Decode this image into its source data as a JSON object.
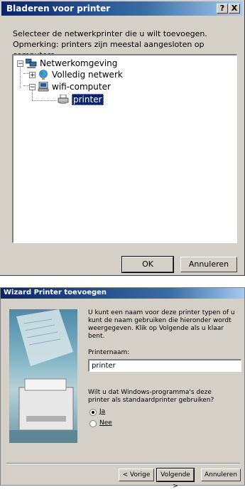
{
  "browse_dialog": {
    "title": "Bladeren voor printer",
    "help_button": "?",
    "close_button": "X",
    "instruction_line1": "Selecteer de netwerkprinter die u wilt toevoegen.",
    "instruction_line2": "Opmerking: printers zijn meestal aangesloten op computers.",
    "tree": [
      {
        "label": "Netwerkomgeving",
        "expander": "−",
        "icon": "network-neighborhood-icon"
      },
      {
        "label": "Volledig netwerk",
        "expander": "+",
        "icon": "globe-icon"
      },
      {
        "label": "wifi-computer",
        "expander": "−",
        "icon": "computer-icon"
      },
      {
        "label": "printer",
        "expander": "",
        "icon": "printer-icon",
        "selected": true
      }
    ],
    "ok_label": "OK",
    "cancel_label": "Annuleren"
  },
  "wizard": {
    "title": "Wizard Printer toevoegen",
    "intro": "U kunt een naam voor deze printer typen of u kunt de naam gebruiken die hieronder wordt weergegeven. Klik op Volgende als u klaar bent.",
    "name_label": "Printernaam:",
    "name_value": "printer",
    "default_question": "Wilt u dat Windows-programma's deze printer als standaardprinter gebruiken?",
    "options": [
      {
        "label": "Ja",
        "selected": true
      },
      {
        "label": "Nee",
        "selected": false
      }
    ],
    "back_label": "< Vorige",
    "next_label": "Volgende >",
    "cancel_label": "Annuleren"
  },
  "colors": {
    "titlebar_start": "#0a246a",
    "titlebar_end": "#a6caf0",
    "dialog_face": "#d4d0c8",
    "selection": "#0a246a"
  }
}
